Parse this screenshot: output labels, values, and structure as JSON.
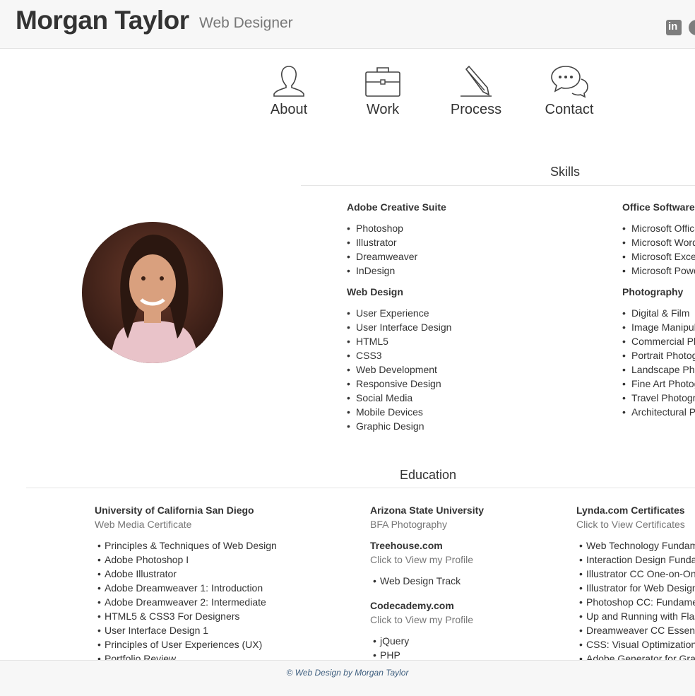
{
  "header": {
    "name": "Morgan Taylor",
    "role": "Web Designer",
    "social": [
      {
        "icon": "linkedin-icon",
        "label": "in"
      },
      {
        "icon": "social-icon"
      }
    ]
  },
  "nav": [
    {
      "label": "About",
      "icon": "person-icon"
    },
    {
      "label": "Work",
      "icon": "briefcase-icon"
    },
    {
      "label": "Process",
      "icon": "pencil-icon"
    },
    {
      "label": "Contact",
      "icon": "chat-bubbles-icon"
    }
  ],
  "skills": {
    "title": "Skills",
    "groups": [
      {
        "title": "Adobe Creative Suite",
        "items": [
          "Photoshop",
          "Illustrator",
          "Dreamweaver",
          "InDesign"
        ]
      },
      {
        "title": "Web Design",
        "items": [
          "User Experience",
          "User Interface Design",
          "HTML5",
          "CSS3",
          "Web Development",
          "Responsive Design",
          "Social Media",
          "Mobile Devices",
          "Graphic Design"
        ]
      },
      {
        "title": "Office Software",
        "items": [
          "Microsoft Office",
          "Microsoft Word",
          "Microsoft Excel",
          "Microsoft PowerPoint"
        ]
      },
      {
        "title": "Photography",
        "items": [
          "Digital & Film",
          "Image Manipulation",
          "Commercial Photography",
          "Portrait Photography",
          "Landscape Photography",
          "Fine Art Photography",
          "Travel Photography",
          "Architectural Photography"
        ]
      }
    ]
  },
  "education": {
    "title": "Education",
    "ucsd": {
      "title": "University of California San Diego",
      "sub": "Web Media Certificate",
      "items": [
        "Principles & Techniques of Web Design",
        "Adobe Photoshop I",
        "Adobe Illustrator",
        "Adobe Dreamweaver 1: Introduction",
        "Adobe Dreamweaver 2: Intermediate",
        "HTML5 & CSS3 For Designers",
        "User Interface Design 1",
        "Principles of User Experiences (UX)",
        "Portfolio Review"
      ]
    },
    "asu": {
      "title": "Arizona State University",
      "sub": "BFA Photography"
    },
    "treehouse": {
      "title": "Treehouse.com",
      "sub": "Click to View my Profile",
      "items": [
        "Web Design Track"
      ]
    },
    "codecademy": {
      "title": "Codecademy.com",
      "sub": "Click to View my Profile",
      "items": [
        "jQuery",
        "PHP"
      ]
    },
    "lynda": {
      "title": "Lynda.com Certificates",
      "sub": "Click to View Certificates",
      "items": [
        "Web Technology Fundamentals",
        "Interaction Design Fundamentals",
        "Illustrator CC One-on-One",
        "Illustrator for Web Design",
        "Photoshop CC: Fundamentals",
        "Up and Running with Flash",
        "Dreamweaver CC Essential Training",
        "CSS: Visual Optimizations",
        "Adobe Generator for Graphics"
      ]
    }
  },
  "footer": {
    "copyright": "© Web Design by Morgan Taylor"
  },
  "colors": {
    "footer_text": "#3f5f7f",
    "muted": "#777777",
    "text": "#333333"
  }
}
